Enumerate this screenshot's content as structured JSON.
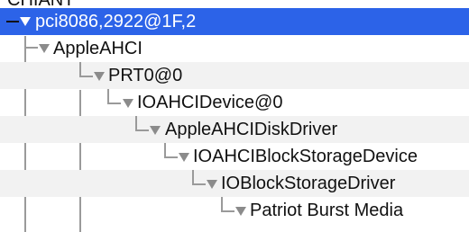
{
  "tree": {
    "partial_top_label": "CHIANT",
    "rows": [
      {
        "label": "pci8086,2922@1F,2",
        "selected": true
      },
      {
        "label": "AppleAHCI",
        "selected": false
      },
      {
        "label": "PRT0@0",
        "selected": false
      },
      {
        "label": "IOAHCIDevice@0",
        "selected": false
      },
      {
        "label": "AppleAHCIDiskDriver",
        "selected": false
      },
      {
        "label": "IOAHCIBlockStorageDevice",
        "selected": false
      },
      {
        "label": "IOBlockStorageDriver",
        "selected": false
      },
      {
        "label": "Patriot Burst Media",
        "selected": false
      }
    ]
  },
  "colors": {
    "selection": "#2c63e8",
    "tree_line": "#9a9a9a",
    "disclosure_triangle": "#8b8b8b",
    "stripe": "#f2f2f2"
  },
  "icons": {
    "disclosure": "disclosure-triangle-down-icon"
  }
}
